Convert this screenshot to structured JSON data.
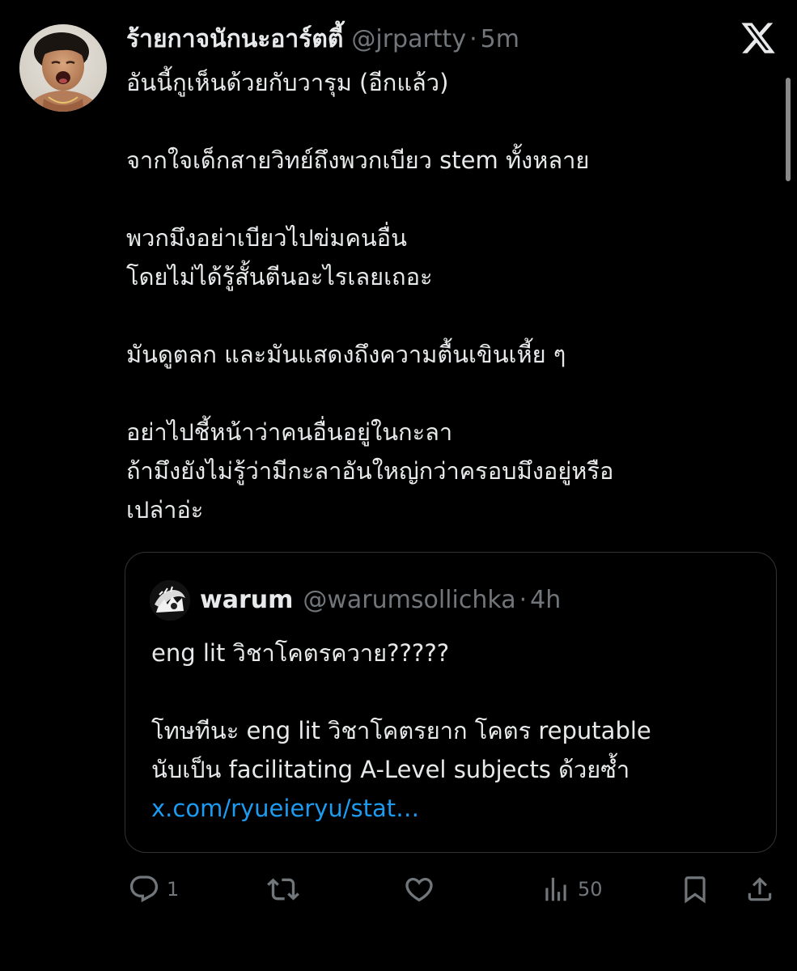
{
  "post": {
    "author_name": "ร้ายกาจนักนะอาร์ตตี้",
    "handle": "@jrpartty",
    "separator": "·",
    "time": "5m",
    "text_lines": [
      "อันนี้กูเห็นด้วยกับวารุม (อีกแล้ว)",
      "",
      "จากใจเด็กสายวิทย์ถึงพวกเบียว stem ทั้งหลาย",
      "",
      "พวกมึงอย่าเบียวไปข่มคนอื่น",
      "โดยไม่ได้รู้สั้นตีนอะไรเลยเถอะ",
      "",
      "มันดูตลก และมันแสดงถึงความตื้นเขินเหี้ย ๆ",
      "",
      "อย่าไปชี้หน้าว่าคนอื่นอยู่ในกะลา",
      "ถ้ามึงยังไม่รู้ว่ามีกะลาอันใหญ่กว่าครอบมึงอยู่หรือ",
      "เปล่าอ่ะ"
    ]
  },
  "quote": {
    "author_name": "warum",
    "handle": "@warumsollichka",
    "separator": "·",
    "time": "4h",
    "text_lines": [
      "eng lit วิชาโคตรควาย?????",
      "",
      "โทษทีนะ eng lit วิชาโคตรยาก โคตร reputable",
      "นับเป็น facilitating A-Level subjects ด้วยซ้ำ"
    ],
    "link": "x.com/ryueieryu/stat…"
  },
  "actions": {
    "reply_count": "1",
    "repost_count": "",
    "like_count": "",
    "views_count": "50"
  },
  "icons": {
    "close": "x-logo-icon",
    "reply": "reply-icon",
    "repost": "repost-icon",
    "like": "heart-icon",
    "views": "views-chart-icon",
    "bookmark": "bookmark-icon",
    "share": "share-icon"
  },
  "colors": {
    "background": "#000000",
    "text": "#e7e9ea",
    "secondary": "#71767b",
    "link": "#1d9bf0",
    "border": "#2f3336"
  }
}
